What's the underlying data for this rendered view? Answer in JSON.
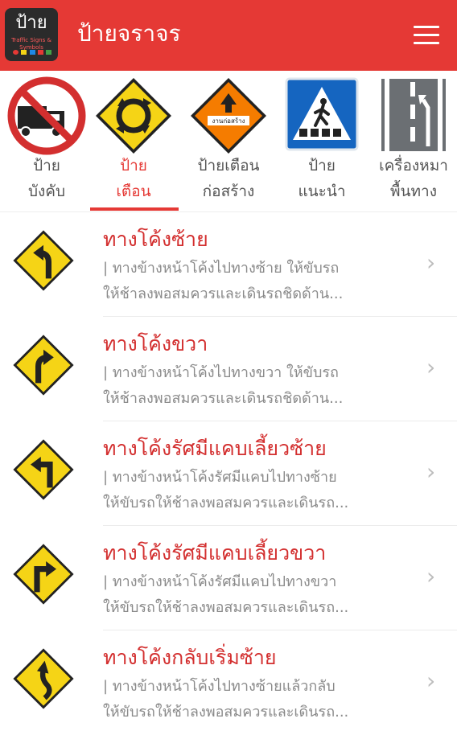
{
  "app": {
    "title": "ป้ายจราจร",
    "logo_main": "ป้าย",
    "logo_sub": "Traffic Signs & Symbols"
  },
  "colors": {
    "accent": "#e53935",
    "title_text": "#d32f2f",
    "desc_text": "#8a8a8a",
    "sign_yellow": "#f5d416",
    "sign_orange": "#f57c00",
    "sign_blue": "#1565c0"
  },
  "tabs": [
    {
      "line1": "ป้าย",
      "line2": "บังคับ",
      "icon": "no-trucks-sign-icon",
      "active": false
    },
    {
      "line1": "ป้าย",
      "line2": "เตือน",
      "icon": "roundabout-warning-sign-icon",
      "active": true
    },
    {
      "line1": "ป้ายเตือน",
      "line2": "ก่อสร้าง",
      "icon": "construction-sign-icon",
      "active": false,
      "sign_text": "งานก่อสร้าง"
    },
    {
      "line1": "ป้าย",
      "line2": "แนะนำ",
      "icon": "pedestrian-crossing-sign-icon",
      "active": false
    },
    {
      "line1": "เครื่องหมา",
      "line2": "พื้นทาง",
      "icon": "road-marking-icon",
      "active": false
    }
  ],
  "items": [
    {
      "title": "ทางโค้งซ้าย",
      "desc1": "| ทางข้างหน้าโค้งไปทางซ้าย ให้ขับรถ",
      "desc2": "ให้ช้าลงพอสมควรและเดินรถชิดด้าน...",
      "icon": "left-curve-sign-icon"
    },
    {
      "title": "ทางโค้งขวา",
      "desc1": "| ทางข้างหน้าโค้งไปทางขวา ให้ขับรถ",
      "desc2": "ให้ช้าลงพอสมควรและเดินรถชิดด้าน...",
      "icon": "right-curve-sign-icon"
    },
    {
      "title": "ทางโค้งรัศมีแคบเลี้ยวซ้าย",
      "desc1": "| ทางข้างหน้าโค้งรัศมีแคบไปทางซ้าย",
      "desc2": "ให้ขับรถให้ช้าลงพอสมควรและเดินรถ...",
      "icon": "sharp-left-turn-sign-icon"
    },
    {
      "title": "ทางโค้งรัศมีแคบเลี้ยวขวา",
      "desc1": "| ทางข้างหน้าโค้งรัศมีแคบไปทางขวา",
      "desc2": "ให้ขับรถให้ช้าลงพอสมควรและเดินรถ...",
      "icon": "sharp-right-turn-sign-icon"
    },
    {
      "title": "ทางโค้งกลับเริ่มซ้าย",
      "desc1": "| ทางข้างหน้าโค้งไปทางซ้ายแล้วกลับ",
      "desc2": "ให้ขับรถให้ช้าลงพอสมควรและเดินรถ...",
      "icon": "reverse-curve-left-sign-icon"
    }
  ],
  "chevron": "›"
}
